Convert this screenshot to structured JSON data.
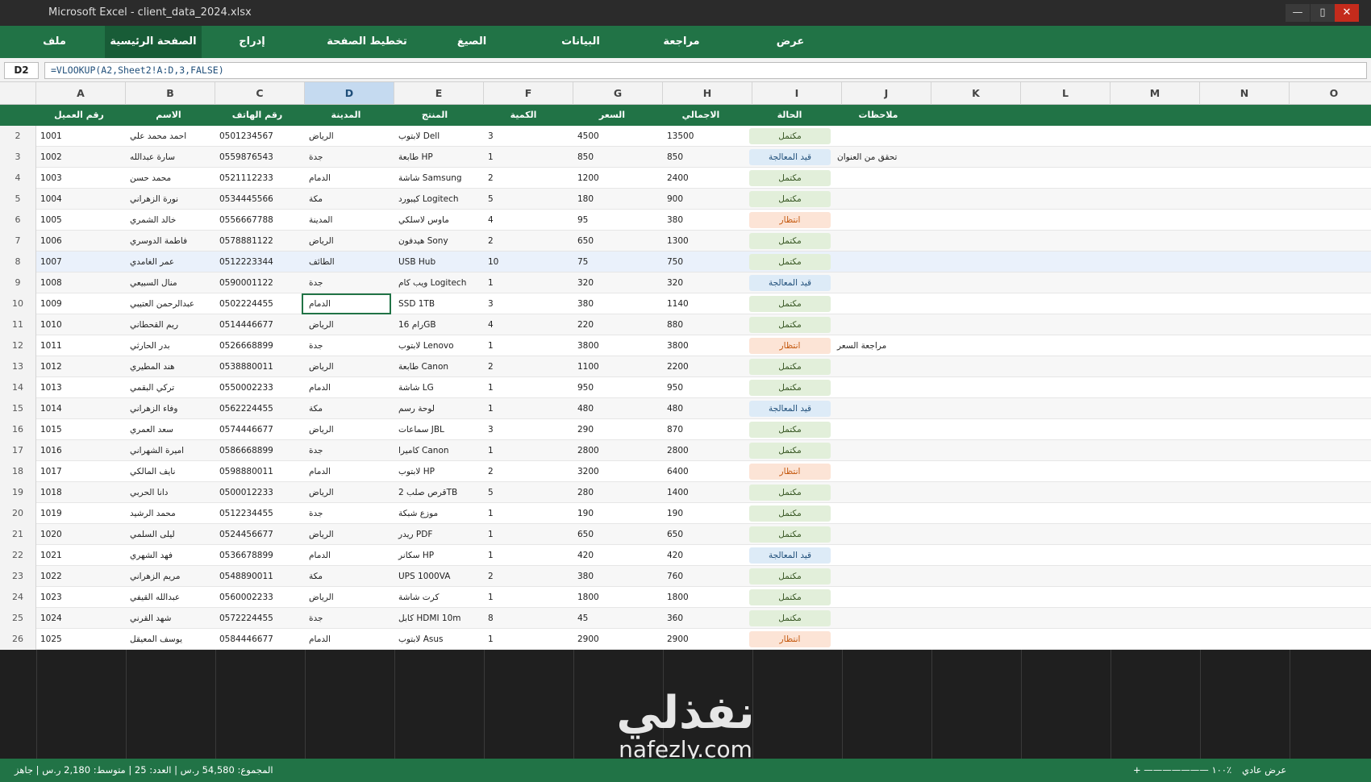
{
  "window": {
    "title": "Microsoft Excel - client_data_2024.xlsx",
    "min": "—",
    "max": "▯",
    "close": "✕"
  },
  "ribbon": {
    "tabs": [
      "ملف",
      "الصفحة الرئيسية",
      "إدراج",
      "تخطيط الصفحة",
      "الصيغ",
      "البيانات",
      "مراجعة",
      "عرض"
    ],
    "active": "الصفحة الرئيسية"
  },
  "formula_bar": {
    "cell_ref": "D2",
    "formula": "=VLOOKUP(A2,Sheet2!A:D,3,FALSE)"
  },
  "columns": [
    "A",
    "B",
    "C",
    "D",
    "E",
    "F",
    "G",
    "H",
    "I",
    "J",
    "K",
    "L",
    "M",
    "N",
    "O"
  ],
  "selected_column": "D",
  "headers": [
    "رقم العميل",
    "الاسم",
    "رقم الهاتف",
    "المدينة",
    "المنتج",
    "الكمية",
    "السعر",
    "الاجمالي",
    "الحالة",
    "ملاحظات"
  ],
  "rows": [
    {
      "n": "2",
      "id": "1001",
      "name": "احمد محمد علي",
      "phone": "0501234567",
      "city": "الرياض",
      "product": "لابتوب Dell",
      "qty": "3",
      "price": "4500",
      "total": "13500",
      "status": "مكتمل",
      "note": ""
    },
    {
      "n": "3",
      "id": "1002",
      "name": "سارة عبدالله",
      "phone": "0559876543",
      "city": "جدة",
      "product": "طابعة HP",
      "qty": "1",
      "price": "850",
      "total": "850",
      "status": "قيد المعالجة",
      "note": "تحقق من العنوان"
    },
    {
      "n": "4",
      "id": "1003",
      "name": "محمد حسن",
      "phone": "0521112233",
      "city": "الدمام",
      "product": "شاشة Samsung",
      "qty": "2",
      "price": "1200",
      "total": "2400",
      "status": "مكتمل",
      "note": ""
    },
    {
      "n": "5",
      "id": "1004",
      "name": "نورة الزهراني",
      "phone": "0534445566",
      "city": "مكة",
      "product": "كيبورد Logitech",
      "qty": "5",
      "price": "180",
      "total": "900",
      "status": "مكتمل",
      "note": ""
    },
    {
      "n": "6",
      "id": "1005",
      "name": "خالد الشمري",
      "phone": "0556667788",
      "city": "المدينة",
      "product": "ماوس لاسلكي",
      "qty": "4",
      "price": "95",
      "total": "380",
      "status": "انتظار",
      "note": ""
    },
    {
      "n": "7",
      "id": "1006",
      "name": "فاطمة الدوسري",
      "phone": "0578881122",
      "city": "الرياض",
      "product": "هيدفون Sony",
      "qty": "2",
      "price": "650",
      "total": "1300",
      "status": "مكتمل",
      "note": ""
    },
    {
      "n": "8",
      "id": "1007",
      "name": "عمر الغامدي",
      "phone": "0512223344",
      "city": "الطائف",
      "product": "USB Hub",
      "qty": "10",
      "price": "75",
      "total": "750",
      "status": "مكتمل",
      "note": ""
    },
    {
      "n": "9",
      "id": "1008",
      "name": "منال السبيعي",
      "phone": "0590001122",
      "city": "جدة",
      "product": "ويب كام Logitech",
      "qty": "1",
      "price": "320",
      "total": "320",
      "status": "قيد المعالجة",
      "note": ""
    },
    {
      "n": "10",
      "id": "1009",
      "name": "عبدالرحمن العتيبي",
      "phone": "0502224455",
      "city": "الدمام",
      "product": "SSD 1TB",
      "qty": "3",
      "price": "380",
      "total": "1140",
      "status": "مكتمل",
      "note": ""
    },
    {
      "n": "11",
      "id": "1010",
      "name": "ريم القحطاني",
      "phone": "0514446677",
      "city": "الرياض",
      "product": "رام 16GB",
      "qty": "4",
      "price": "220",
      "total": "880",
      "status": "مكتمل",
      "note": ""
    },
    {
      "n": "12",
      "id": "1011",
      "name": "بدر الحارثي",
      "phone": "0526668899",
      "city": "جدة",
      "product": "لابتوب Lenovo",
      "qty": "1",
      "price": "3800",
      "total": "3800",
      "status": "انتظار",
      "note": "مراجعة السعر"
    },
    {
      "n": "13",
      "id": "1012",
      "name": "هند المطيري",
      "phone": "0538880011",
      "city": "الرياض",
      "product": "طابعة Canon",
      "qty": "2",
      "price": "1100",
      "total": "2200",
      "status": "مكتمل",
      "note": ""
    },
    {
      "n": "14",
      "id": "1013",
      "name": "تركي البقمي",
      "phone": "0550002233",
      "city": "الدمام",
      "product": "شاشة LG",
      "qty": "1",
      "price": "950",
      "total": "950",
      "status": "مكتمل",
      "note": ""
    },
    {
      "n": "15",
      "id": "1014",
      "name": "وفاء الزهراني",
      "phone": "0562224455",
      "city": "مكة",
      "product": "لوحة رسم",
      "qty": "1",
      "price": "480",
      "total": "480",
      "status": "قيد المعالجة",
      "note": ""
    },
    {
      "n": "16",
      "id": "1015",
      "name": "سعد العمري",
      "phone": "0574446677",
      "city": "الرياض",
      "product": "سماعات JBL",
      "qty": "3",
      "price": "290",
      "total": "870",
      "status": "مكتمل",
      "note": ""
    },
    {
      "n": "17",
      "id": "1016",
      "name": "اميرة الشهراني",
      "phone": "0586668899",
      "city": "جدة",
      "product": "كاميرا Canon",
      "qty": "1",
      "price": "2800",
      "total": "2800",
      "status": "مكتمل",
      "note": ""
    },
    {
      "n": "18",
      "id": "1017",
      "name": "نايف المالكي",
      "phone": "0598880011",
      "city": "الدمام",
      "product": "لابتوب HP",
      "qty": "2",
      "price": "3200",
      "total": "6400",
      "status": "انتظار",
      "note": ""
    },
    {
      "n": "19",
      "id": "1018",
      "name": "دانا الحربي",
      "phone": "0500012233",
      "city": "الرياض",
      "product": "قرص صلب 2TB",
      "qty": "5",
      "price": "280",
      "total": "1400",
      "status": "مكتمل",
      "note": ""
    },
    {
      "n": "20",
      "id": "1019",
      "name": "محمد الرشيد",
      "phone": "0512234455",
      "city": "جدة",
      "product": "موزع شبكة",
      "qty": "1",
      "price": "190",
      "total": "190",
      "status": "مكتمل",
      "note": ""
    },
    {
      "n": "21",
      "id": "1020",
      "name": "ليلى السلمي",
      "phone": "0524456677",
      "city": "الرياض",
      "product": "ريدر PDF",
      "qty": "1",
      "price": "650",
      "total": "650",
      "status": "مكتمل",
      "note": ""
    },
    {
      "n": "22",
      "id": "1021",
      "name": "فهد الشهري",
      "phone": "0536678899",
      "city": "الدمام",
      "product": "سكانر HP",
      "qty": "1",
      "price": "420",
      "total": "420",
      "status": "قيد المعالجة",
      "note": ""
    },
    {
      "n": "23",
      "id": "1022",
      "name": "مريم الزهراني",
      "phone": "0548890011",
      "city": "مكة",
      "product": "UPS 1000VA",
      "qty": "2",
      "price": "380",
      "total": "760",
      "status": "مكتمل",
      "note": ""
    },
    {
      "n": "24",
      "id": "1023",
      "name": "عبدالله القيفي",
      "phone": "0560002233",
      "city": "الرياض",
      "product": "كرت شاشة",
      "qty": "1",
      "price": "1800",
      "total": "1800",
      "status": "مكتمل",
      "note": ""
    },
    {
      "n": "25",
      "id": "1024",
      "name": "شهد القرني",
      "phone": "0572224455",
      "city": "جدة",
      "product": "كابل HDMI 10m",
      "qty": "8",
      "price": "45",
      "total": "360",
      "status": "مكتمل",
      "note": ""
    },
    {
      "n": "26",
      "id": "1025",
      "name": "يوسف المعيقل",
      "phone": "0584446677",
      "city": "الدمام",
      "product": "لابتوب Asus",
      "qty": "1",
      "price": "2900",
      "total": "2900",
      "status": "انتظار",
      "note": ""
    }
  ],
  "status_colors": {
    "مكتمل": {
      "bg": "#e2efda",
      "fg": "#375623"
    },
    "قيد المعالجة": {
      "bg": "#ddebf7",
      "fg": "#1f4e79"
    },
    "انتظار": {
      "bg": "#fce4d6",
      "fg": "#c55a11"
    }
  },
  "watermark": {
    "arabic": "نفذلي",
    "latin": "nafezly.com"
  },
  "status_bar": {
    "left": "المجموع: 54,580 ر.س   |   العدد: 25   |   متوسط: 2,180 ر.س   |   جاهز",
    "zoom": "+  ———————  ١٠٠٪",
    "view": "عرض عادي"
  }
}
